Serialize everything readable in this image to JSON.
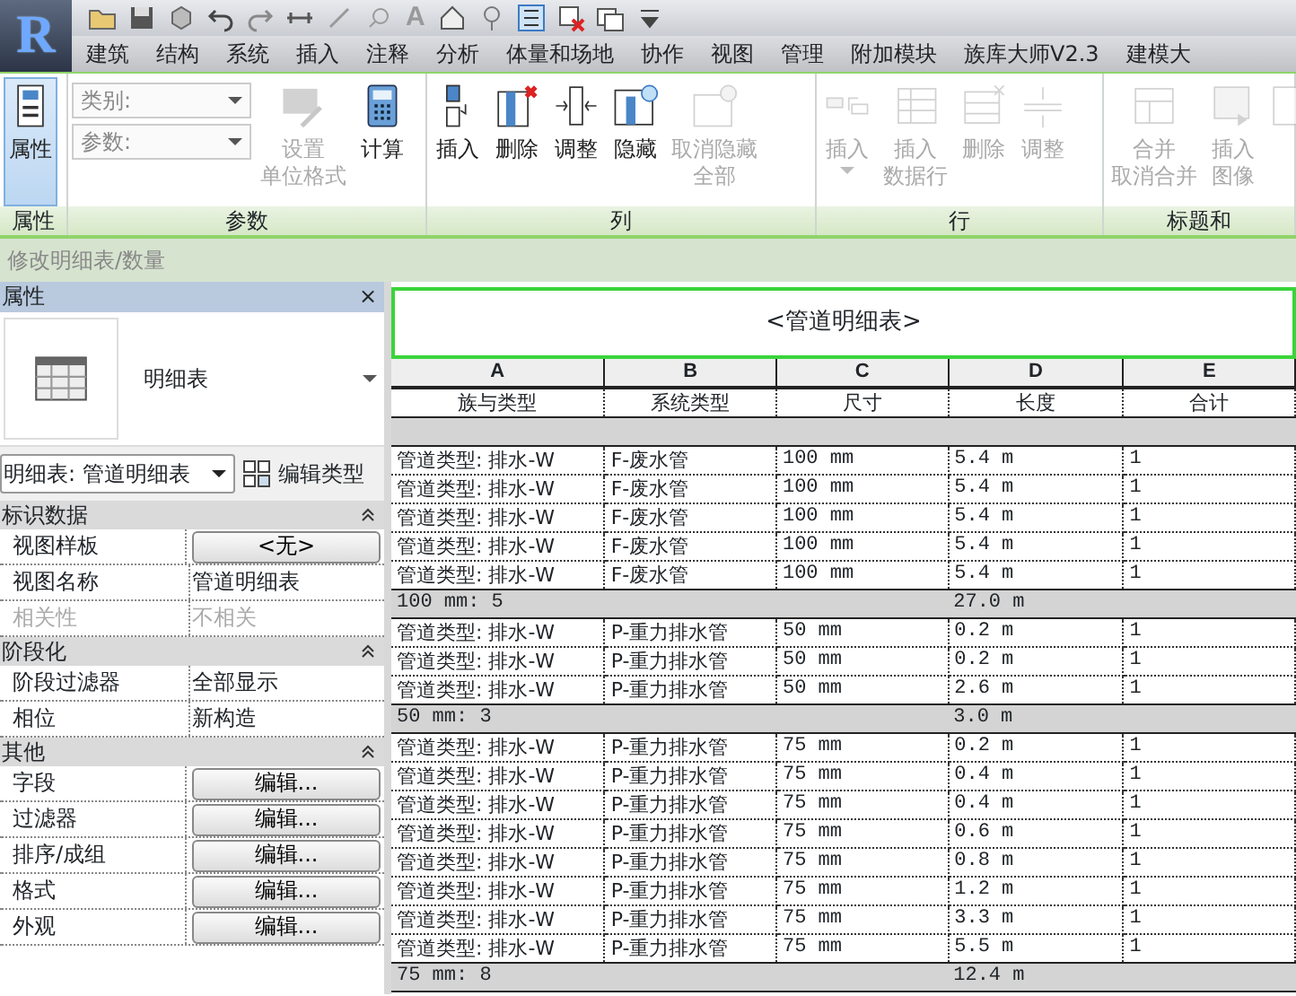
{
  "quick_access": {
    "logo": "R",
    "text_tool": "A"
  },
  "tabs": [
    "建筑",
    "结构",
    "系统",
    "插入",
    "注释",
    "分析",
    "体量和场地",
    "协作",
    "视图",
    "管理",
    "附加模块",
    "族库大师V2.3",
    "建模大"
  ],
  "ribbon": [
    {
      "title": "属性",
      "controls": [
        {
          "kind": "large",
          "label": "属性",
          "disabled": false,
          "selected": true
        }
      ]
    },
    {
      "title": "参数",
      "controls": [
        {
          "kind": "combo",
          "label": "类别:",
          "disabled": false
        },
        {
          "kind": "combo",
          "label": "参数:",
          "disabled": false
        },
        {
          "kind": "large",
          "lines": [
            "设置",
            "单位格式"
          ],
          "disabled": true
        },
        {
          "kind": "large",
          "label": "计算",
          "disabled": false
        }
      ]
    },
    {
      "title": "列",
      "controls": [
        {
          "kind": "large",
          "label": "插入",
          "disabled": false
        },
        {
          "kind": "large",
          "label": "删除",
          "disabled": false
        },
        {
          "kind": "large",
          "label": "调整",
          "disabled": false
        },
        {
          "kind": "large",
          "label": "隐藏",
          "disabled": false
        },
        {
          "kind": "large",
          "lines": [
            "取消隐藏",
            "全部"
          ],
          "disabled": true
        }
      ]
    },
    {
      "title": "行",
      "controls": [
        {
          "kind": "split",
          "label": "插入",
          "disabled": true
        },
        {
          "kind": "large",
          "lines": [
            "插入",
            "数据行"
          ],
          "disabled": true
        },
        {
          "kind": "large",
          "label": "删除",
          "disabled": true
        },
        {
          "kind": "large",
          "label": "调整",
          "disabled": true
        }
      ]
    },
    {
      "title": "标题和",
      "controls": [
        {
          "kind": "large",
          "lines": [
            "合并",
            "取消合并"
          ],
          "disabled": true
        },
        {
          "kind": "large",
          "lines": [
            "插入",
            "图像"
          ],
          "disabled": true
        },
        {
          "kind": "large",
          "disabled": true
        }
      ]
    }
  ],
  "context_label": "修改明细表/数量",
  "properties": {
    "title": "属性",
    "close": "×",
    "type_name": "明细表",
    "type_selector": "明细表: 管道明细表",
    "edit_type": "编辑类型",
    "groups": [
      {
        "name": "标识数据",
        "rows": [
          {
            "label": "视图样板",
            "value": "<无>",
            "kind": "button",
            "disabled": false
          },
          {
            "label": "视图名称",
            "value": "管道明细表",
            "kind": "text",
            "disabled": false
          },
          {
            "label": "相关性",
            "value": "不相关",
            "kind": "text",
            "disabled": true
          }
        ]
      },
      {
        "name": "阶段化",
        "rows": [
          {
            "label": "阶段过滤器",
            "value": "全部显示",
            "kind": "text",
            "disabled": false
          },
          {
            "label": "相位",
            "value": "新构造",
            "kind": "text",
            "disabled": false
          }
        ]
      },
      {
        "name": "其他",
        "rows": [
          {
            "label": "字段",
            "value": "编辑...",
            "kind": "button",
            "disabled": false
          },
          {
            "label": "过滤器",
            "value": "编辑...",
            "kind": "button",
            "disabled": false
          },
          {
            "label": "排序/成组",
            "value": "编辑...",
            "kind": "button",
            "disabled": false
          },
          {
            "label": "格式",
            "value": "编辑...",
            "kind": "button",
            "disabled": false
          },
          {
            "label": "外观",
            "value": "编辑...",
            "kind": "button",
            "disabled": false
          }
        ]
      }
    ]
  },
  "schedule": {
    "title": "<管道明细表>",
    "column_letters": [
      "A",
      "B",
      "C",
      "D",
      "E"
    ],
    "headers": [
      "族与类型",
      "系统类型",
      "尺寸",
      "长度",
      "合计"
    ],
    "rows": [
      {
        "kind": "blank"
      },
      {
        "kind": "data",
        "cells": [
          "管道类型: 排水-W",
          "F-废水管",
          "100 mm",
          "5.4 m",
          "1"
        ]
      },
      {
        "kind": "data",
        "cells": [
          "管道类型: 排水-W",
          "F-废水管",
          "100 mm",
          "5.4 m",
          "1"
        ]
      },
      {
        "kind": "data",
        "cells": [
          "管道类型: 排水-W",
          "F-废水管",
          "100 mm",
          "5.4 m",
          "1"
        ]
      },
      {
        "kind": "data",
        "cells": [
          "管道类型: 排水-W",
          "F-废水管",
          "100 mm",
          "5.4 m",
          "1"
        ]
      },
      {
        "kind": "data",
        "cells": [
          "管道类型: 排水-W",
          "F-废水管",
          "100 mm",
          "5.4 m",
          "1"
        ]
      },
      {
        "kind": "subtotal",
        "label": "100 mm: 5",
        "total": "27.0 m"
      },
      {
        "kind": "data",
        "cells": [
          "管道类型: 排水-W",
          "P-重力排水管",
          "50 mm",
          "0.2 m",
          "1"
        ]
      },
      {
        "kind": "data",
        "cells": [
          "管道类型: 排水-W",
          "P-重力排水管",
          "50 mm",
          "0.2 m",
          "1"
        ]
      },
      {
        "kind": "data",
        "cells": [
          "管道类型: 排水-W",
          "P-重力排水管",
          "50 mm",
          "2.6 m",
          "1"
        ]
      },
      {
        "kind": "subtotal",
        "label": "50 mm: 3",
        "total": "3.0 m"
      },
      {
        "kind": "data",
        "cells": [
          "管道类型: 排水-W",
          "P-重力排水管",
          "75 mm",
          "0.2 m",
          "1"
        ]
      },
      {
        "kind": "data",
        "cells": [
          "管道类型: 排水-W",
          "P-重力排水管",
          "75 mm",
          "0.4 m",
          "1"
        ]
      },
      {
        "kind": "data",
        "cells": [
          "管道类型: 排水-W",
          "P-重力排水管",
          "75 mm",
          "0.4 m",
          "1"
        ]
      },
      {
        "kind": "data",
        "cells": [
          "管道类型: 排水-W",
          "P-重力排水管",
          "75 mm",
          "0.6 m",
          "1"
        ]
      },
      {
        "kind": "data",
        "cells": [
          "管道类型: 排水-W",
          "P-重力排水管",
          "75 mm",
          "0.8 m",
          "1"
        ]
      },
      {
        "kind": "data",
        "cells": [
          "管道类型: 排水-W",
          "P-重力排水管",
          "75 mm",
          "1.2 m",
          "1"
        ]
      },
      {
        "kind": "data",
        "cells": [
          "管道类型: 排水-W",
          "P-重力排水管",
          "75 mm",
          "3.3 m",
          "1"
        ]
      },
      {
        "kind": "data",
        "cells": [
          "管道类型: 排水-W",
          "P-重力排水管",
          "75 mm",
          "5.5 m",
          "1"
        ]
      },
      {
        "kind": "subtotal",
        "label": "75 mm: 8",
        "total": "12.4 m"
      }
    ]
  }
}
